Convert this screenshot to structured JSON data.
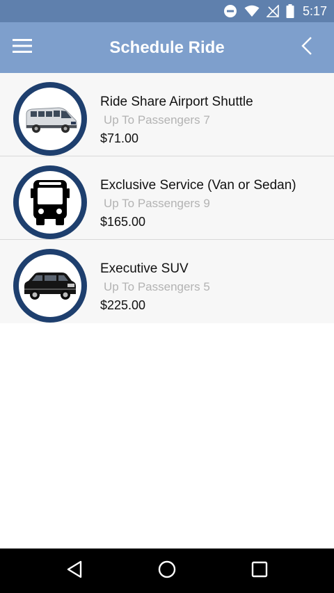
{
  "status_bar": {
    "time": "5:17",
    "icons": [
      "do-not-disturb-icon",
      "wifi-icon",
      "no-signal-icon",
      "battery-icon"
    ]
  },
  "app_bar": {
    "title": "Schedule Ride",
    "left_icon": "hamburger-menu-icon",
    "right_icon": "chevron-left-icon"
  },
  "rides": [
    {
      "name": "Ride Share Airport Shuttle",
      "capacity": "Up To Passengers 7",
      "price": "$71.00",
      "image": "van-image"
    },
    {
      "name": "Exclusive Service (Van or Sedan)",
      "capacity": "Up To Passengers 9",
      "price": "$165.00",
      "image": "bus-icon"
    },
    {
      "name": "Executive SUV",
      "capacity": "Up To Passengers 5",
      "price": "$225.00",
      "image": "suv-image"
    }
  ],
  "nav_bar": {
    "icons": [
      "back-triangle-icon",
      "home-circle-icon",
      "recents-square-icon"
    ]
  },
  "colors": {
    "status_bar": "#5f80ad",
    "app_bar": "#7e9fcc",
    "thumb_ring": "#1e3f6e",
    "row_background": "#f7f7f7",
    "capacity_text": "#b3b3b3"
  }
}
